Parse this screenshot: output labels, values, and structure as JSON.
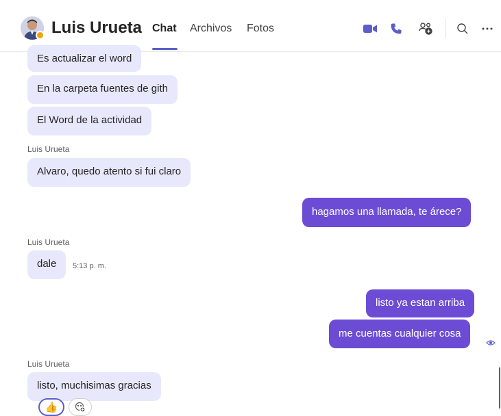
{
  "header": {
    "contact_name": "Luis Urueta",
    "tabs": [
      "Chat",
      "Archivos",
      "Fotos"
    ],
    "active_tab": "Chat",
    "icons": [
      "video-call-icon",
      "audio-call-icon",
      "add-people-icon",
      "search-icon",
      "more-icon"
    ],
    "accent_color": "#5b5fc7",
    "status_color": "#f0a30a"
  },
  "messages": {
    "group1": [
      "Es actualizar el word",
      "En la carpeta fuentes de gith",
      "El Word de la actividad"
    ],
    "sender1": "Luis Urueta",
    "msg_alvaro": "Alvaro, quedo atento si fui claro",
    "out1": "hagamos una llamada, te árece?",
    "sender2": "Luis Urueta",
    "msg_dale": "dale",
    "dale_time": "5:13 p. m.",
    "out2": "listo ya estan arriba",
    "out3": "me cuentas cualquier cosa",
    "sender3": "Luis Urueta",
    "msg_final": "listo, muchisimas gracias"
  },
  "reactions": {
    "like_emoji": "👍",
    "add_icon": "add-reaction-icon"
  },
  "colors": {
    "incoming_bubble": "#e8e8fc",
    "outgoing_bubble": "#6c4cd4"
  }
}
